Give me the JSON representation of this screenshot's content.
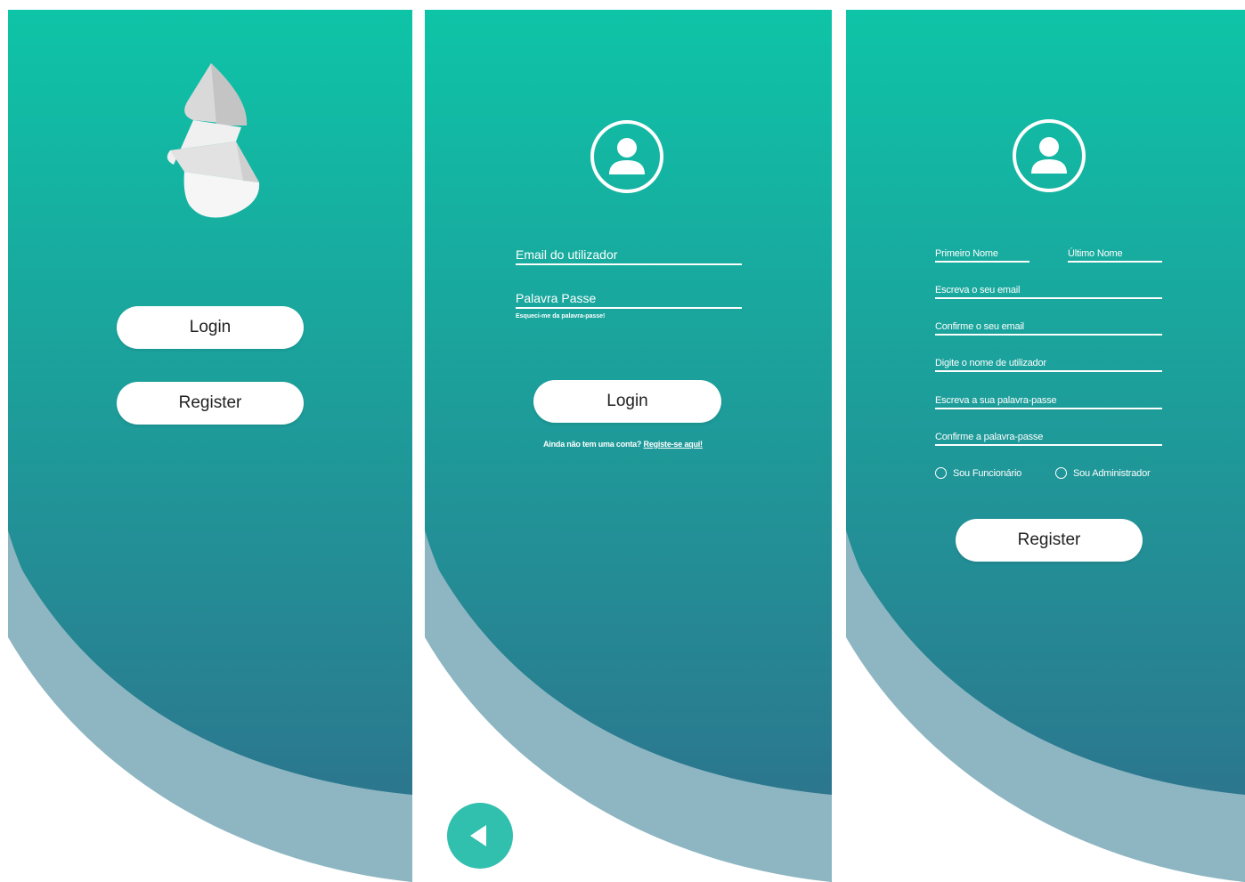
{
  "colors": {
    "gradient_top": "#0ec4a7",
    "gradient_bottom": "#2f6e8b",
    "wave_light": "#8db6c2",
    "button_bg": "#ffffff",
    "back_button": "#31bfae"
  },
  "screen1": {
    "logo_icon": "folded-drop-logo",
    "login_label": "Login",
    "register_label": "Register"
  },
  "screen2": {
    "avatar_icon": "user-circle-icon",
    "email_placeholder": "Email do utilizador",
    "password_placeholder": "Palavra Passe",
    "forgot_prefix": "Esqueci-me da ",
    "forgot_link": "palavra-passe!",
    "login_label": "Login",
    "no_account_text": "Ainda não tem uma conta? ",
    "register_link": "Registe-se aqui!",
    "back_icon": "back-arrow-icon"
  },
  "screen3": {
    "avatar_icon": "user-circle-icon",
    "first_name": "Primeiro Nome",
    "last_name": "Último Nome",
    "email": "Escreva o seu email",
    "confirm_email": "Confirme o seu email",
    "username": "Digite o nome de utilizador",
    "password": "Escreva a sua palavra-passe",
    "confirm_password": "Confirme a palavra-passe",
    "radio_employee": "Sou Funcionário",
    "radio_admin": "Sou Administrador",
    "register_label": "Register"
  }
}
